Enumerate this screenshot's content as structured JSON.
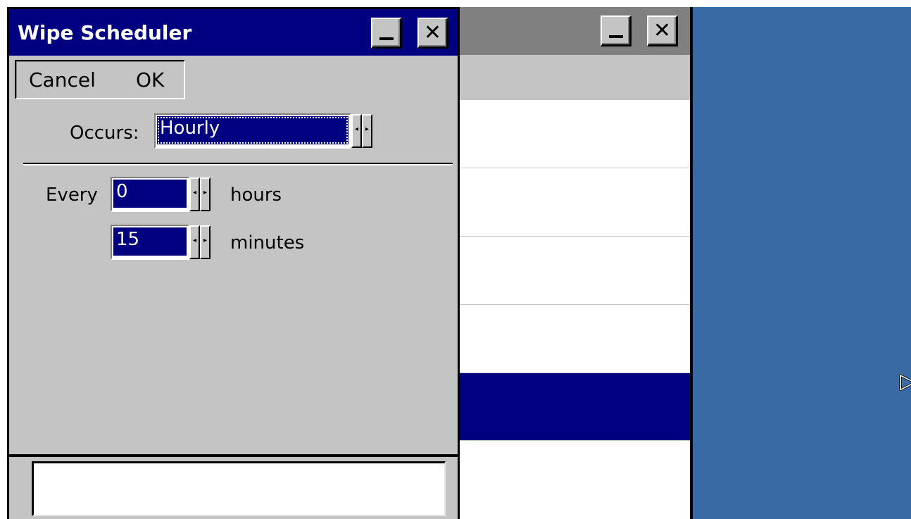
{
  "dialog": {
    "title": "Wipe Scheduler",
    "minimize_icon": "minimize-icon",
    "close_icon": "close-icon",
    "close_glyph": "✕"
  },
  "commands": {
    "cancel_label": "Cancel",
    "ok_label": "OK"
  },
  "form": {
    "occurs_label": "Occurs:",
    "occurs_value": "Hourly",
    "every_label": "Every",
    "hours_value": "0",
    "hours_label": "hours",
    "minutes_value": "15",
    "minutes_label": "minutes"
  },
  "background_window": {
    "close_glyph": "✕"
  },
  "colors": {
    "titlebar": "#000080",
    "dialog_face": "#c4c4c4",
    "desktop": "#396aa4",
    "selection": "#000080"
  }
}
